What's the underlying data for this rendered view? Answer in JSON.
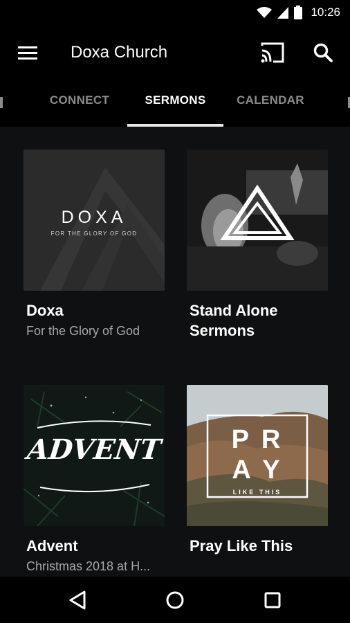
{
  "status_bar": {
    "time": "10:26"
  },
  "app_bar": {
    "title": "Doxa Church"
  },
  "tabs": [
    {
      "label": "CONNECT"
    },
    {
      "label": "SERMONS",
      "active": true
    },
    {
      "label": "CALENDAR"
    }
  ],
  "cards": [
    {
      "title": "Doxa",
      "subtitle": "For the Glory of God",
      "art": {
        "wordmark": "DOXA",
        "tagline": "FOR THE GLORY OF GOD"
      }
    },
    {
      "title": "Stand Alone Sermons",
      "subtitle": ""
    },
    {
      "title": "Advent",
      "subtitle": "Christmas 2018 at H...",
      "art": {
        "wordmark": "ADVENT"
      }
    },
    {
      "title": "Pray Like This",
      "subtitle": "",
      "art": {
        "line1": "P R",
        "line2": "A Y",
        "tagline": "LIKE THIS"
      }
    }
  ],
  "colors": {
    "background": "#0f1011",
    "bar": "#000000",
    "inactive_tab": "#8b8b8b",
    "subtitle": "#a8a8a8"
  }
}
